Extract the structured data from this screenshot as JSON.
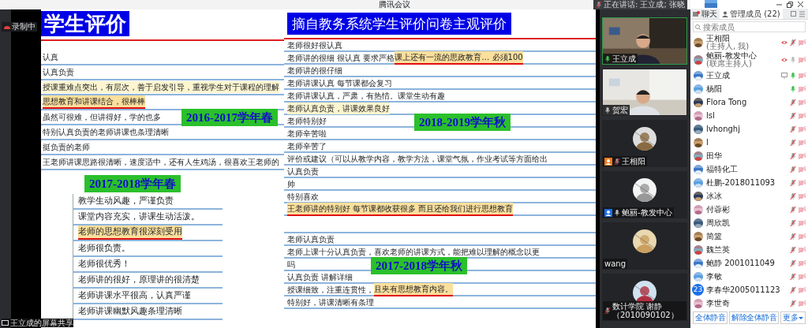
{
  "window": {
    "title": "腾讯会议"
  },
  "recording": {
    "label": "录制中"
  },
  "speaking_banner": {
    "text": "正在讲话: 王立成; 张晓"
  },
  "share_label": {
    "text": "王立成的屏幕共享"
  },
  "slide_left": {
    "title": "学生评价",
    "rows": [
      {
        "text": "认真",
        "highlighted": false,
        "underlined": false
      },
      {
        "text": "认真负责",
        "highlighted": false,
        "underlined": false
      },
      {
        "text": "授课重难点突出，有层次，善于启发引导，重视学生对于课程的理解",
        "highlighted": true,
        "color": "#fdf5cf",
        "underlined": false
      },
      {
        "text": "思想教育和讲课结合，很棒棒",
        "highlighted": true,
        "color": "#fbdf9c",
        "underlined": true
      },
      {
        "text": "虽然可很难，但讲得好，学的也多",
        "highlighted": false,
        "underlined": false,
        "term_label": "2016-2017学年春"
      },
      {
        "text": "特别认真负责的老师讲课也条理清晰",
        "highlighted": false,
        "underlined": false
      },
      {
        "text": "挺负责的老师",
        "highlighted": false,
        "underlined": false
      },
      {
        "text": "王老师讲课思路很清晰，速度适中，还有人生鸡汤，很喜欢王老师的",
        "highlighted": false,
        "underlined": false
      }
    ],
    "section": {
      "label": "2017-2018学年春",
      "items": [
        {
          "text": "教学生动风趣，严谨负责",
          "highlighted": false,
          "underlined": false
        },
        {
          "text": "课堂内容充实，讲课生动活泼。",
          "highlighted": false,
          "underlined": false
        },
        {
          "text": "老师的思想教育很深刻受用",
          "highlighted": true,
          "color": "#fbdf9c",
          "underlined": true
        },
        {
          "text": "老师很负责。",
          "highlighted": false,
          "underlined": false
        },
        {
          "text": "老师很优秀！",
          "highlighted": false,
          "underlined": false
        },
        {
          "text": "老师讲的很好，原理讲的很清楚",
          "highlighted": false,
          "underlined": false
        },
        {
          "text": "老师讲课水平很高，认真严谨",
          "highlighted": false,
          "underlined": false
        },
        {
          "text": "老师讲课幽默风趣条理清晰",
          "highlighted": false,
          "underlined": false
        }
      ]
    }
  },
  "slide_right": {
    "title": "摘自教务系统学生评价问卷主观评价",
    "rows": [
      {
        "kind": "comment",
        "text": "老师很好很认真",
        "highlighted": false,
        "underlined": false
      },
      {
        "kind": "comment",
        "text": "老师讲的很细 很认真 要求严格",
        "highlighted": false,
        "underlined": false,
        "extra": {
          "text": "课上还有一流的思政教育… 必须100",
          "highlighted": true,
          "color": "#fbdf9c",
          "underlined": true
        }
      },
      {
        "kind": "comment",
        "text": "老师讲的很仔细",
        "highlighted": false,
        "underlined": false
      },
      {
        "kind": "comment",
        "text": "老师讲课认真 每节课都会复习",
        "highlighted": false,
        "underlined": false
      },
      {
        "kind": "comment",
        "text": "老师讲课认真，严肃，有热情。课堂生动有趣",
        "highlighted": false,
        "underlined": false
      },
      {
        "kind": "comment",
        "text": "老师认真负责，讲课效果良好",
        "highlighted": true,
        "color": "#fdf5cf",
        "underlined": false
      },
      {
        "kind": "comment",
        "text": "老师特别好",
        "highlighted": false,
        "underlined": false,
        "term_label": "2018-2019学年秋"
      },
      {
        "kind": "comment",
        "text": "老师辛苦啦",
        "highlighted": false,
        "underlined": false
      },
      {
        "kind": "comment",
        "text": "老师辛苦了",
        "highlighted": false,
        "underlined": false
      },
      {
        "kind": "comment",
        "text": "评价或建议（可以从教学内容，教学方法，课堂气氛，作业考试等方面给出",
        "highlighted": false,
        "underlined": false
      },
      {
        "kind": "comment",
        "text": "认真负责",
        "highlighted": false,
        "underlined": false
      },
      {
        "kind": "comment",
        "text": "帅",
        "highlighted": false,
        "underlined": false
      },
      {
        "kind": "comment",
        "text": "特别喜欢",
        "highlighted": false,
        "underlined": false
      },
      {
        "kind": "comment",
        "text": "王老师讲的特别好 每节课都收获很多 而且还给我们进行思想教育",
        "highlighted": true,
        "color": "#fbdf9c",
        "underlined": true
      },
      {
        "kind": "blank"
      },
      {
        "kind": "comment",
        "text": "老师认真负责",
        "highlighted": false,
        "underlined": false
      },
      {
        "kind": "comment",
        "text": "老师上课十分认真负责，喜欢老师的讲课方式，能把难以理解的概念以更",
        "highlighted": false,
        "underlined": false
      },
      {
        "kind": "comment",
        "text": "吗",
        "highlighted": false,
        "underlined": false,
        "term_label": "2017-2018学年秋"
      },
      {
        "kind": "comment",
        "text": "认真负责 讲解详细",
        "highlighted": false,
        "underlined": false
      },
      {
        "kind": "comment",
        "text": "授课细致，注重连贯性，",
        "highlighted": false,
        "underlined": false,
        "extra": {
          "text": "且夹有思想教育内容。",
          "highlighted": true,
          "color": "#fbdf9c",
          "underlined": true
        }
      },
      {
        "kind": "comment",
        "text": "特别好，讲课清晰有条理",
        "highlighted": false,
        "underlined": false
      }
    ]
  },
  "video_tiles": [
    {
      "kind": "camera",
      "name": "王立成",
      "mic_icon": true,
      "muted": false,
      "speaking": true,
      "host": false,
      "cohost": false,
      "active": true
    },
    {
      "kind": "camera",
      "name": "贺宏",
      "mic_icon": true,
      "muted": false,
      "speaking": false,
      "host": false,
      "cohost": false,
      "active": false
    },
    {
      "kind": "avatar",
      "name": "王相阳",
      "mic_icon": true,
      "muted": true,
      "speaking": false,
      "host": true,
      "cohost": false,
      "active": false
    },
    {
      "kind": "avatar",
      "name": "鲍丽-教发中心",
      "mic_icon": true,
      "muted": false,
      "speaking": false,
      "host": false,
      "cohost": true,
      "active": false
    },
    {
      "kind": "avatar",
      "name": "wang",
      "mic_icon": false,
      "host": false,
      "cohost": false,
      "active": false
    },
    {
      "kind": "avatar",
      "name": "数计学院 谢静（2010090102）",
      "mic_icon": true,
      "muted": true,
      "speaking": false,
      "host": false,
      "cohost": false,
      "active": false
    }
  ],
  "panel": {
    "tabs": [
      {
        "label": "聊天",
        "selected": false
      },
      {
        "label": "管理成员 (22)",
        "selected": true
      }
    ],
    "search": {
      "placeholder": "搜索成员"
    },
    "participants": [
      {
        "name": "王相阳",
        "subtitle": "(主持人, 我)",
        "muted": true,
        "speaking": false,
        "sharing": true,
        "device": false
      },
      {
        "name": "鲍丽-教发中心",
        "subtitle": "(联席主持人)",
        "muted": false,
        "speaking": false,
        "sharing": true,
        "device": false
      },
      {
        "name": "王立成",
        "muted": false,
        "speaking": true,
        "sharing": false,
        "device": true
      },
      {
        "name": "杨阳",
        "muted": false,
        "speaking": true,
        "sharing": false,
        "device": false
      },
      {
        "name": "Flora Tong",
        "muted": true,
        "speaking": false,
        "sharing": false,
        "device": false
      },
      {
        "name": "lsl",
        "muted": true,
        "speaking": false,
        "sharing": false,
        "device": false
      },
      {
        "name": "lvhonghj",
        "muted": true,
        "speaking": false,
        "sharing": false,
        "device": false
      },
      {
        "name": "l",
        "muted": true,
        "speaking": false,
        "sharing": false,
        "device": false
      },
      {
        "name": "田华",
        "muted": true,
        "speaking": false,
        "sharing": false,
        "device": false
      },
      {
        "name": "福特化工",
        "muted": true,
        "speaking": false,
        "sharing": false,
        "device": false
      },
      {
        "name": "杜鹏-2018011093",
        "muted": true,
        "speaking": false,
        "sharing": false,
        "device": false
      },
      {
        "name": "冰冰",
        "muted": true,
        "speaking": false,
        "sharing": false,
        "device": false
      },
      {
        "name": "付蓉彬",
        "muted": true,
        "speaking": false,
        "sharing": false,
        "device": false
      },
      {
        "name": "周欣凯",
        "muted": true,
        "speaking": false,
        "sharing": false,
        "device": false
      },
      {
        "name": "简篮",
        "muted": true,
        "speaking": false,
        "sharing": false,
        "device": false
      },
      {
        "name": "魏兰英",
        "muted": true,
        "speaking": false,
        "sharing": false,
        "device": false
      },
      {
        "name": "鲍静 2001011049",
        "muted": true,
        "speaking": false,
        "sharing": false,
        "device": false
      },
      {
        "name": "李敏",
        "muted": true,
        "speaking": false,
        "sharing": false,
        "device": false
      },
      {
        "name": "李春华2005011123",
        "muted": true,
        "speaking": false,
        "sharing": false,
        "device": false,
        "avatar_text": "23"
      },
      {
        "name": "李世奇",
        "muted": true,
        "speaking": false,
        "sharing": false,
        "device": false
      }
    ],
    "buttons": [
      {
        "label": "全体静音",
        "kind": "plain"
      },
      {
        "label": "解除全体静音",
        "kind": "plain"
      },
      {
        "label": "更多",
        "kind": "menu"
      }
    ]
  }
}
